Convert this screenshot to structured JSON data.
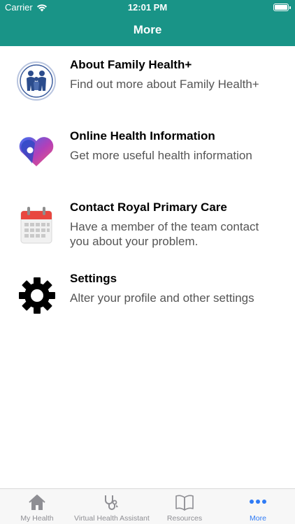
{
  "status_bar": {
    "carrier": "Carrier",
    "time": "12:01 PM"
  },
  "header": {
    "title": "More"
  },
  "menu": {
    "items": [
      {
        "title": "About Family Health+",
        "description": "Find out more about Family Health+",
        "icon": "family-icon"
      },
      {
        "title": "Online Health Information",
        "description": "Get more useful health information",
        "icon": "heart-location-icon"
      },
      {
        "title": "Contact Royal Primary Care",
        "description": "Have a member of the team contact you about your problem.",
        "icon": "calendar-icon"
      },
      {
        "title": "Settings",
        "description": "Alter your profile and other settings",
        "icon": "gear-icon"
      }
    ]
  },
  "tab_bar": {
    "tabs": [
      {
        "label": "My Health",
        "icon": "home-icon",
        "active": false
      },
      {
        "label": "Virtual Health Assistant",
        "icon": "stethoscope-icon",
        "active": false
      },
      {
        "label": "Resources",
        "icon": "book-icon",
        "active": false
      },
      {
        "label": "More",
        "icon": "more-dots-icon",
        "active": true
      }
    ]
  },
  "colors": {
    "header_bg": "#199487",
    "active_tab": "#2f7bf5",
    "inactive_tab": "#8e8e93"
  }
}
